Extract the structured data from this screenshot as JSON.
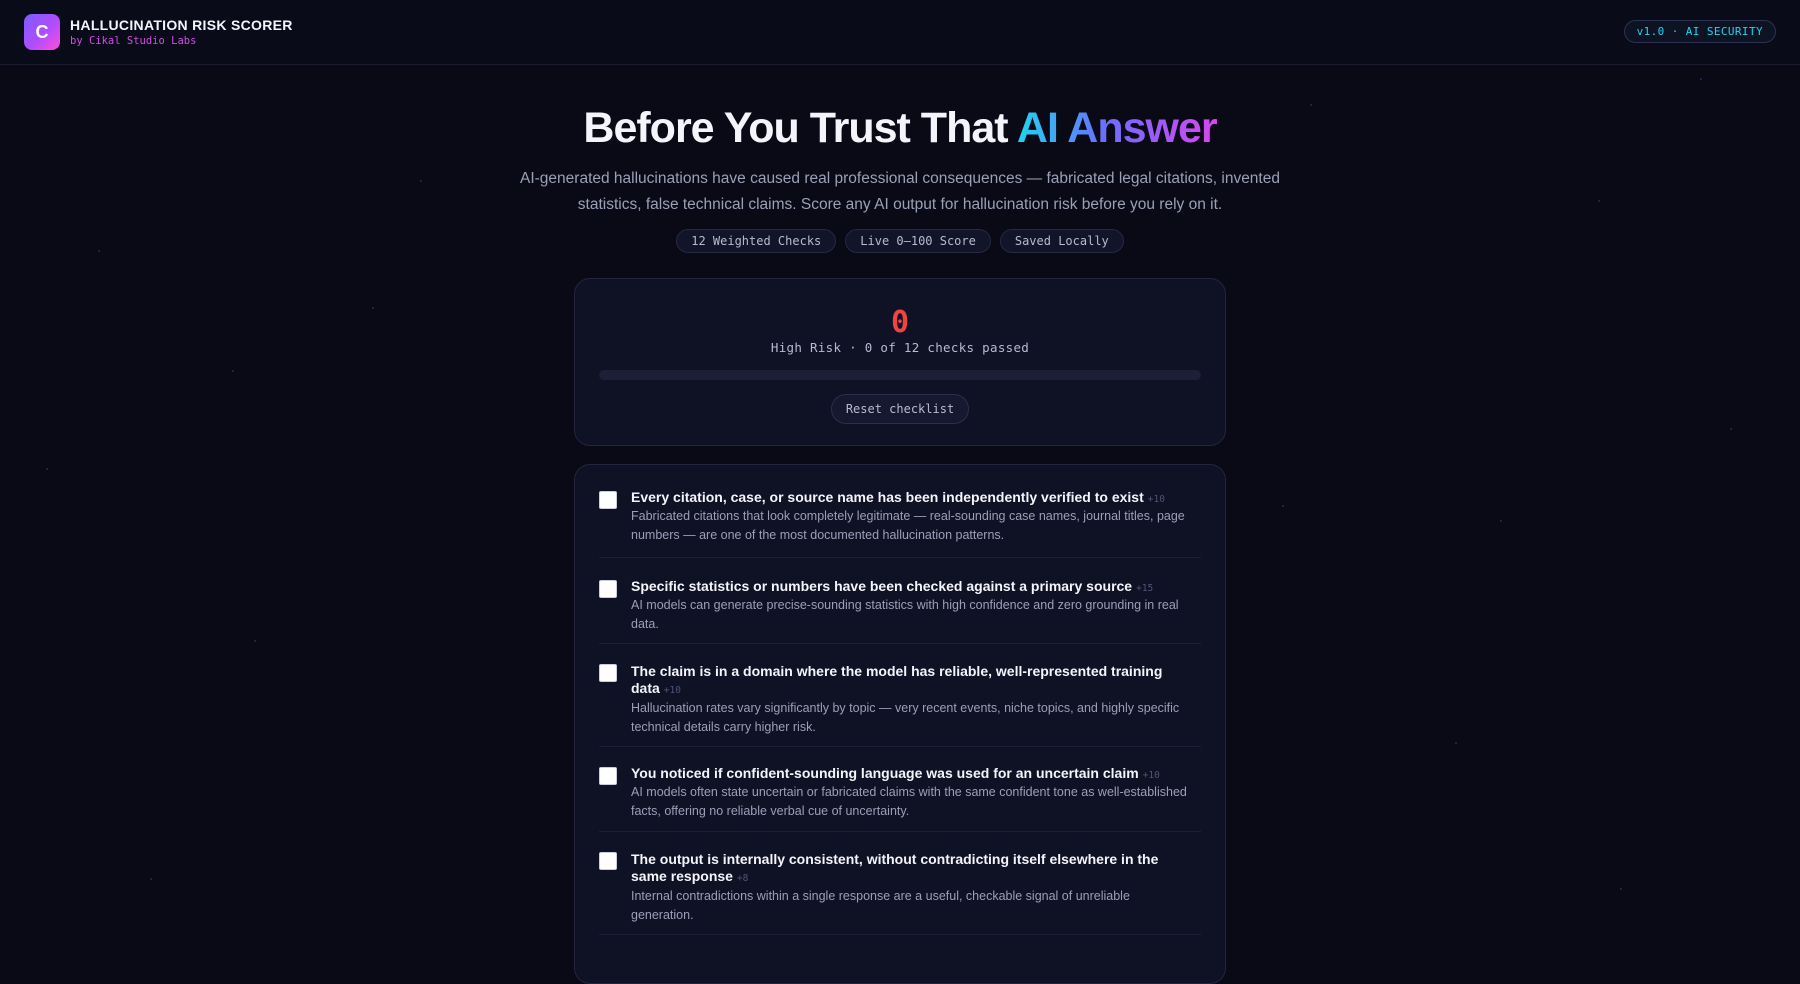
{
  "header": {
    "logo_letter": "C",
    "app_title": "HALLUCINATION RISK SCORER",
    "app_subtitle": "by Cikal Studio Labs",
    "version_badge": "v1.0 · AI SECURITY"
  },
  "hero": {
    "title_plain": "Before You Trust That ",
    "title_accent": "AI Answer",
    "description": "AI-generated hallucinations have caused real professional consequences — fabricated legal citations, invented statistics, false technical claims. Score any AI output for hallucination risk before you rely on it.",
    "pills": [
      "12 Weighted Checks",
      "Live 0–100 Score",
      "Saved Locally"
    ]
  },
  "score": {
    "value": "0",
    "label": "High Risk · 0 of 12 checks passed",
    "progress_fraction": 0,
    "reset_label": "Reset checklist",
    "risk_color": "#ef4444"
  },
  "checklist": [
    {
      "title": "Every citation, case, or source name has been independently verified to exist",
      "weight": "+10",
      "description": "Fabricated citations that look completely legitimate — real-sounding case names, journal titles, page numbers — are one of the most documented hallucination patterns.",
      "checked": false
    },
    {
      "title": "Specific statistics or numbers have been checked against a primary source",
      "weight": "+15",
      "description": "AI models can generate precise-sounding statistics with high confidence and zero grounding in real data.",
      "checked": false
    },
    {
      "title": "The claim is in a domain where the model has reliable, well-represented training data",
      "weight": "+10",
      "description": "Hallucination rates vary significantly by topic — very recent events, niche topics, and highly specific technical details carry higher risk.",
      "checked": false
    },
    {
      "title": "You noticed if confident-sounding language was used for an uncertain claim",
      "weight": "+10",
      "description": "AI models often state uncertain or fabricated claims with the same confident tone as well-established facts, offering no reliable verbal cue of uncertainty.",
      "checked": false
    },
    {
      "title": "The output is internally consistent, without contradicting itself elsewhere in the same response",
      "weight": "+8",
      "description": "Internal contradictions within a single response are a useful, checkable signal of unreliable generation.",
      "checked": false
    }
  ]
}
